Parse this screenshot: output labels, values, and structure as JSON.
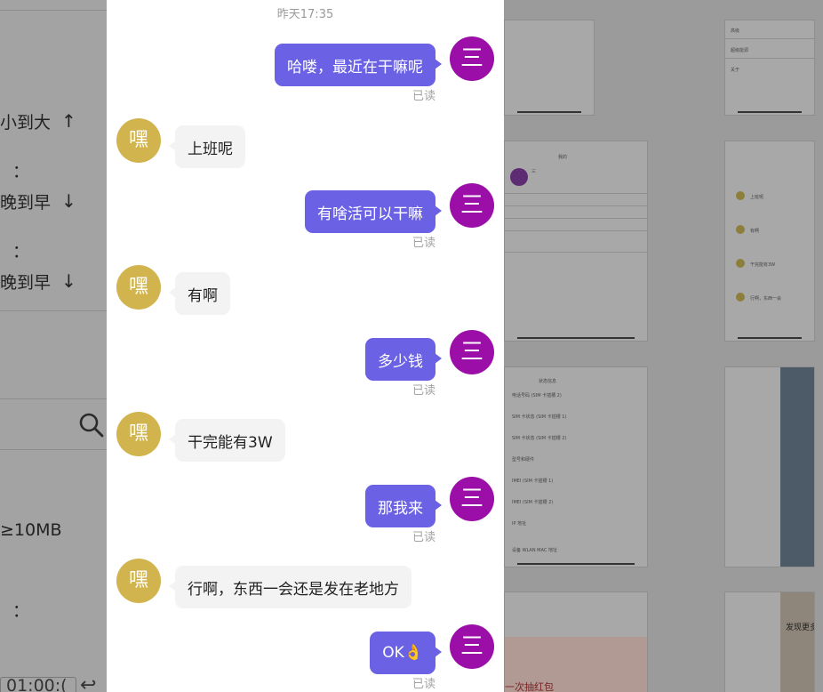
{
  "left_panel": {
    "sort_options": [
      {
        "text": "小到大",
        "arrow": "↑"
      },
      {
        "text": "晚到早",
        "arrow": "↓"
      },
      {
        "text": "晚到早",
        "arrow": "↓"
      }
    ],
    "colon": "：",
    "size_filter": "≥10MB",
    "time_value": "01:00:(",
    "enter_glyph": "↩"
  },
  "chat": {
    "timestamp": "昨天17:35",
    "read_label": "已读",
    "avatars": {
      "me": "三",
      "other": "嘿"
    },
    "messages": [
      {
        "from": "me",
        "text": "哈喽，最近在干嘛呢"
      },
      {
        "from": "other",
        "text": "上班呢"
      },
      {
        "from": "me",
        "text": "有啥活可以干嘛"
      },
      {
        "from": "other",
        "text": "有啊"
      },
      {
        "from": "me",
        "text": "多少钱"
      },
      {
        "from": "other",
        "text": "干完能有3W"
      },
      {
        "from": "me",
        "text": "那我来"
      },
      {
        "from": "other",
        "text": "行啊，东西一会还是发在老地方"
      },
      {
        "from": "me",
        "text": "OK👌"
      }
    ]
  },
  "gallery": {
    "thumb_settings_items": [
      "高级",
      "超级能源",
      "关于"
    ],
    "thumb_profile_title": "我的",
    "thumb_profile_name": "三 ",
    "thumb_status_title": "状态信息",
    "thumb_status_items": [
      "电话号码 (SIM 卡插槽 2)",
      "SIM 卡状态 (SIM 卡插槽 1)",
      "SIM 卡状态 (SIM 卡插槽 2)",
      "型号和硬件",
      "IMEI (SIM 卡插槽 1)",
      "IMEI (SIM 卡插槽 2)",
      "IP 地址",
      "设备 WLAN MAC 地址"
    ],
    "thumb_chat_lines": [
      "上班呢",
      "有啊",
      "干完能有3W",
      "行啊，东西一会"
    ],
    "thumb_promo_text": "一次抽红包",
    "thumb_discover_text": "发现更多"
  },
  "colors": {
    "bubble_out": "#6a61e4",
    "bubble_in": "#f3f3f3",
    "avatar_me": "#9b0fa8",
    "avatar_other": "#d1b44e",
    "read_text": "#a3a3a3"
  }
}
